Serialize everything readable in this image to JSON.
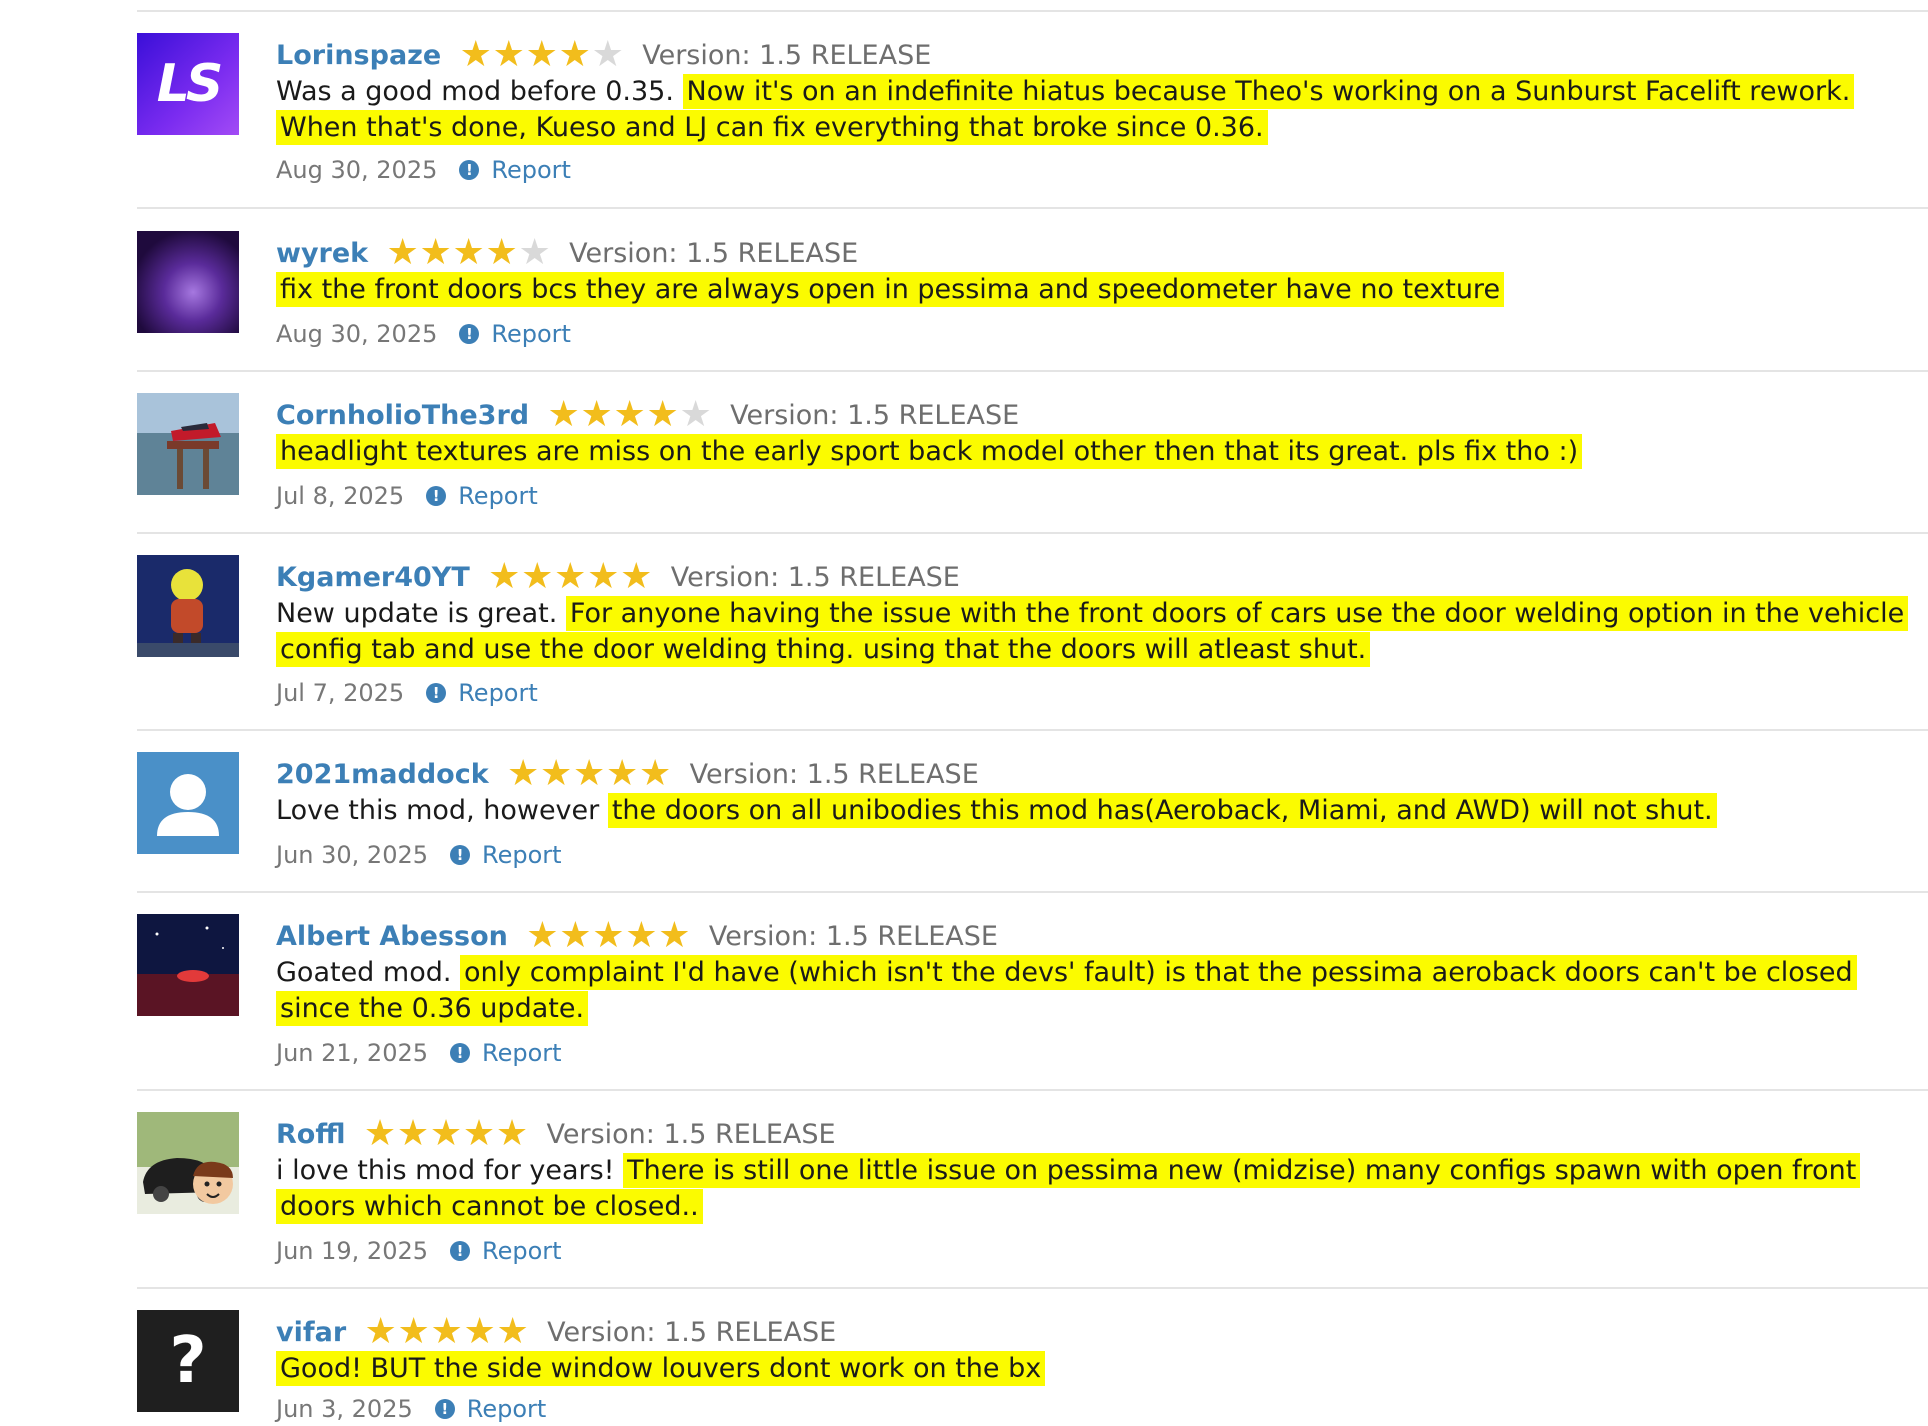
{
  "common": {
    "report_label": "Report",
    "report_icon": "exclamation-circle-icon"
  },
  "colors": {
    "link": "#3c7fb6",
    "star": "#f2bd1c",
    "star_empty": "#d9d9d9",
    "highlight": "#fbfb00"
  },
  "reviews": [
    {
      "username": "Lorinspaze",
      "rating": 4,
      "version": "Version: 1.5 RELEASE",
      "text_plain": "Was a good mod before 0.35. ",
      "text_highlight": "Now it's on an indefinite hiatus because Theo's working on a Sunburst Facelift rework. When that's done, Kueso and LJ can fix everything that broke since 0.36.",
      "date": "Aug 30, 2025",
      "avatar_initials": "LS"
    },
    {
      "username": "wyrek",
      "rating": 4,
      "version": "Version: 1.5 RELEASE",
      "text_plain": "",
      "text_highlight": "fix the front doors bcs they are always open in pessima and speedometer have no texture",
      "date": "Aug 30, 2025"
    },
    {
      "username": "CornholioThe3rd",
      "rating": 4,
      "version": "Version: 1.5 RELEASE",
      "text_plain": "",
      "text_highlight": "headlight textures are miss on the early sport back model other then that its great. pls fix tho :)",
      "date": "Jul 8, 2025"
    },
    {
      "username": "Kgamer40YT",
      "rating": 5,
      "version": "Version: 1.5 RELEASE",
      "text_plain": "New update is great. ",
      "text_highlight": "For anyone having the issue with the front doors of cars use the door welding option in the vehicle config tab and use the door welding thing. using that the doors will atleast shut.",
      "date": "Jul 7, 2025"
    },
    {
      "username": "2021maddock",
      "rating": 5,
      "version": "Version: 1.5 RELEASE",
      "text_plain": "Love this mod, however ",
      "text_highlight": "the doors on all unibodies this mod has(Aeroback, Miami, and AWD) will not shut.",
      "date": "Jun 30, 2025"
    },
    {
      "username": "Albert Abesson",
      "rating": 5,
      "version": "Version: 1.5 RELEASE",
      "text_plain": "Goated mod. ",
      "text_highlight": "only complaint I'd have (which isn't the devs' fault) is that the pessima aeroback doors can't be closed since the 0.36 update.",
      "date": "Jun 21, 2025"
    },
    {
      "username": "Roffl",
      "rating": 5,
      "version": "Version: 1.5 RELEASE",
      "text_plain": "i love this mod for years! ",
      "text_highlight": "There is still one little issue on pessima new (midzise) many configs spawn with open front doors which cannot be closed..",
      "date": "Jun 19, 2025"
    },
    {
      "username": "vifar",
      "rating": 5,
      "version": "Version: 1.5 RELEASE",
      "text_plain": "",
      "text_highlight": "Good! BUT the side window louvers dont work on the bx",
      "date": "Jun 3, 2025",
      "avatar_glyph": "?"
    }
  ]
}
